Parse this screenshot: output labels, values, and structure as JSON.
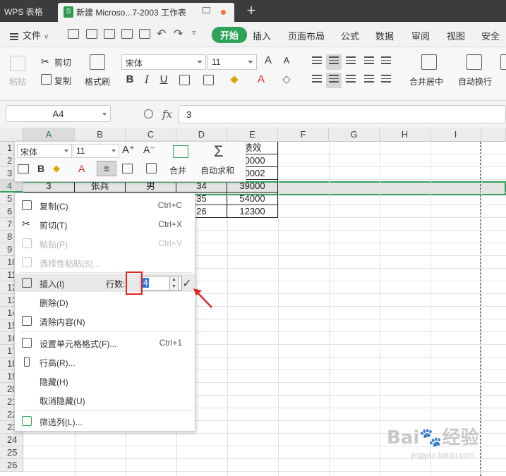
{
  "titlebar": {
    "app_name": "WPS 表格",
    "doc_title": "新建 Microso...7-2003 工作表",
    "new_tab": "+"
  },
  "menubar": {
    "file": "文件",
    "tabs": [
      "开始",
      "插入",
      "页面布局",
      "公式",
      "数据",
      "审阅",
      "视图",
      "安全"
    ],
    "active_tab": "开始"
  },
  "ribbon": {
    "paste": "粘贴",
    "cut": "剪切",
    "copy": "复制",
    "format_painter": "格式刷",
    "font_name": "宋体",
    "font_size": "11",
    "merge_center": "合并居中",
    "wrap_text": "自动换行"
  },
  "formula_bar": {
    "name_box": "A4",
    "fx": "fx",
    "value": "3"
  },
  "sheet": {
    "columns": [
      "A",
      "B",
      "C",
      "D",
      "E",
      "F",
      "G",
      "H",
      "I"
    ],
    "rows": [
      "1",
      "2",
      "3",
      "4",
      "5",
      "6",
      "7",
      "8",
      "9",
      "10",
      "11",
      "12",
      "13",
      "14",
      "15",
      "16",
      "17",
      "18",
      "19",
      "20",
      "21",
      "22",
      "23",
      "24",
      "25",
      "26"
    ],
    "selected_row": "4",
    "selected_col": "A",
    "visible_cells": [
      {
        "ref": "E1",
        "text": "绩效"
      },
      {
        "ref": "E2",
        "text": "30000"
      },
      {
        "ref": "E3",
        "text": "30002"
      },
      {
        "ref": "A4",
        "text": "3"
      },
      {
        "ref": "B4",
        "text": "张兵"
      },
      {
        "ref": "C4",
        "text": "男"
      },
      {
        "ref": "D4",
        "text": "34"
      },
      {
        "ref": "E4",
        "text": "39000"
      },
      {
        "ref": "D5",
        "text": "35"
      },
      {
        "ref": "E5",
        "text": "54000"
      },
      {
        "ref": "D6",
        "text": "26"
      },
      {
        "ref": "E6",
        "text": "12300"
      }
    ]
  },
  "mini_toolbar": {
    "font_name": "宋体",
    "font_size": "11",
    "grow_font": "A⁺",
    "shrink_font": "A⁻",
    "merge": "合并",
    "autosum": "自动求和"
  },
  "context_menu": {
    "items": [
      {
        "label": "复制(C)",
        "shortcut": "Ctrl+C",
        "disabled": false
      },
      {
        "label": "剪切(T)",
        "shortcut": "Ctrl+X",
        "disabled": false
      },
      {
        "label": "粘贴(P)",
        "shortcut": "Ctrl+V",
        "disabled": true
      },
      {
        "label": "选择性粘贴(S)...",
        "shortcut": "",
        "disabled": true
      },
      {
        "label": "插入(I)",
        "shortcut": "",
        "disabled": false
      },
      {
        "label": "删除(D)",
        "shortcut": "",
        "disabled": false
      },
      {
        "label": "清除内容(N)",
        "shortcut": "",
        "disabled": false
      },
      {
        "label": "设置单元格格式(F)...",
        "shortcut": "Ctrl+1",
        "disabled": false
      },
      {
        "label": "行高(R)...",
        "shortcut": "",
        "disabled": false
      },
      {
        "label": "隐藏(H)",
        "shortcut": "",
        "disabled": false
      },
      {
        "label": "取消隐藏(U)",
        "shortcut": "",
        "disabled": false
      },
      {
        "label": "筛选列(L)...",
        "shortcut": "",
        "disabled": false
      }
    ],
    "rows_label": "行数:",
    "rows_value": "4"
  },
  "watermark": {
    "brand": "Bai",
    "brand_cn": "经验",
    "url": "jingyan.baidu.com"
  },
  "colors": {
    "accent": "#2fa35a",
    "highlight_box": "#e0262a",
    "input_selection": "#2f7de1"
  }
}
